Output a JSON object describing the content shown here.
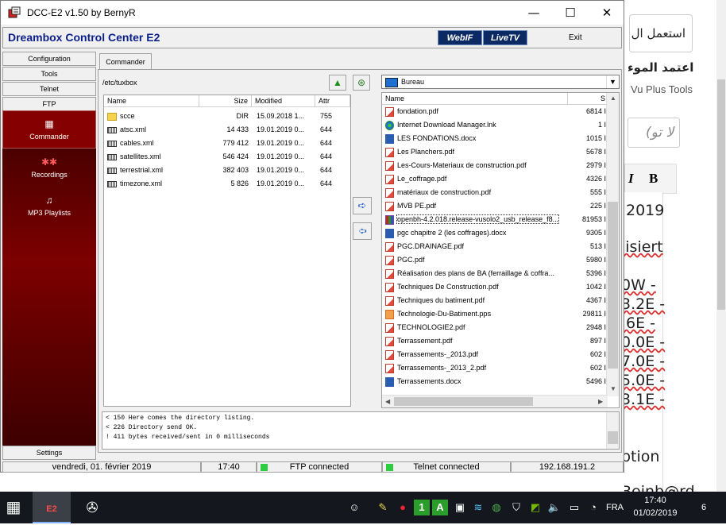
{
  "window": {
    "title": "DCC-E2 v1.50 by BernyR",
    "minimize": "—",
    "maximize": "☐",
    "close": "✕"
  },
  "header": {
    "brand": "Dreambox Control Center E2",
    "logo_webif": "WebIF",
    "logo_livetv": "LiveTV",
    "exit": "Exit"
  },
  "nav": {
    "buttons": [
      "Configuration",
      "Tools",
      "Telnet",
      "FTP"
    ],
    "items": [
      {
        "label": "Commander",
        "icon": "grid-icon",
        "glyph": "▦"
      },
      {
        "label": "Recordings",
        "icon": "recordings-icon",
        "glyph": "✱✱"
      },
      {
        "label": "MP3 Playlists",
        "icon": "playlist-icon",
        "glyph": "♫"
      }
    ],
    "settings": "Settings"
  },
  "commander": {
    "tab": "Commander",
    "left_path": "/etc/tuxbox",
    "left_columns": [
      "Name",
      "Size",
      "Modified",
      "Attr"
    ],
    "left_files": [
      {
        "name": "scce",
        "size": "DIR",
        "modified": "15.09.2018 1...",
        "attr": "755",
        "type": "folder"
      },
      {
        "name": "atsc.xml",
        "size": "14 433",
        "modified": "19.01.2019 0...",
        "attr": "644",
        "type": "xml"
      },
      {
        "name": "cables.xml",
        "size": "779 412",
        "modified": "19.01.2019 0...",
        "attr": "644",
        "type": "xml"
      },
      {
        "name": "satellites.xml",
        "size": "546 424",
        "modified": "19.01.2019 0...",
        "attr": "644",
        "type": "xml"
      },
      {
        "name": "terrestrial.xml",
        "size": "382 403",
        "modified": "19.01.2019 0...",
        "attr": "644",
        "type": "xml"
      },
      {
        "name": "timezone.xml",
        "size": "5 826",
        "modified": "19.01.2019 0...",
        "attr": "644",
        "type": "xml"
      }
    ],
    "right_location": "Bureau",
    "right_columns": [
      "Name",
      "S"
    ],
    "right_files": [
      {
        "name": "fondation.pdf",
        "size": "6814 I",
        "type": "pdf"
      },
      {
        "name": "Internet Download Manager.lnk",
        "size": "1 I",
        "type": "lnk"
      },
      {
        "name": "LES FONDATIONS.docx",
        "size": "1015 I",
        "type": "doc"
      },
      {
        "name": "Les Planchers.pdf",
        "size": "5678 I",
        "type": "pdf"
      },
      {
        "name": "Les-Cours-Materiaux de construction.pdf",
        "size": "2979 I",
        "type": "pdf"
      },
      {
        "name": "Le_coffrage.pdf",
        "size": "4326 I",
        "type": "pdf"
      },
      {
        "name": "matériaux de construction.pdf",
        "size": "555 I",
        "type": "pdf"
      },
      {
        "name": "MVB PE.pdf",
        "size": "225 I",
        "type": "pdf"
      },
      {
        "name": "openbh-4.2.018.release-vusolo2_usb_release_f8...",
        "size": "81953 I",
        "type": "zip",
        "selected": true
      },
      {
        "name": "pgc chapitre 2 (les coffrages).docx",
        "size": "9305 I",
        "type": "doc"
      },
      {
        "name": "PGC.DRAINAGE.pdf",
        "size": "513 I",
        "type": "pdf"
      },
      {
        "name": "PGC.pdf",
        "size": "5980 I",
        "type": "pdf"
      },
      {
        "name": "Réalisation des plans de BA (ferraillage & coffra...",
        "size": "5396 I",
        "type": "pdf"
      },
      {
        "name": "Techniques De Construction.pdf",
        "size": "1042 I",
        "type": "pdf"
      },
      {
        "name": "Techniques du batiment.pdf",
        "size": "4367 I",
        "type": "pdf"
      },
      {
        "name": "Technologie-Du-Batiment.pps",
        "size": "29811 I",
        "type": "pps"
      },
      {
        "name": "TECHNOLOGIE2.pdf",
        "size": "2948 I",
        "type": "pdf"
      },
      {
        "name": "Terrassement.pdf",
        "size": "897 I",
        "type": "pdf"
      },
      {
        "name": "Terrassements-_2013.pdf",
        "size": "602 I",
        "type": "pdf"
      },
      {
        "name": "Terrassements-_2013_2.pdf",
        "size": "602 I",
        "type": "pdf"
      },
      {
        "name": "Terrassements.docx",
        "size": "5496 I",
        "type": "doc"
      }
    ],
    "log": [
      "< 150 Here comes the directory listing.",
      "< 226 Directory send OK.",
      "! 411 bytes received/sent in 0 milliseconds"
    ]
  },
  "status": {
    "date": "vendredi, 01. février 2019",
    "time": "17:40",
    "ftp": "FTP connected",
    "telnet": "Telnet connected",
    "ip": "192.168.191.2"
  },
  "background_page": {
    "box_text": "استعمل ال",
    "heading": "اعتمد الموء",
    "vuplus": "Vu Plus Tools",
    "placeholder": "(لا تو",
    "italic": "I",
    "bold": "B",
    "lines": [
      "2019",
      "lisiert",
      "0W -",
      "3.2E -",
      ".6E -",
      "0.0E -",
      "7.0E -",
      "5.0E -",
      "3.1E -",
      "ption",
      "Beinb@rd"
    ]
  },
  "taskbar": {
    "language": "FRA",
    "clock_time": "17:40",
    "clock_date": "01/02/2019",
    "notifications": "6"
  },
  "colors": {
    "brand": "#0b1f8c",
    "nav_dark": "#7d0000",
    "taskbar": "#14171d",
    "led": "#2ecc40"
  }
}
